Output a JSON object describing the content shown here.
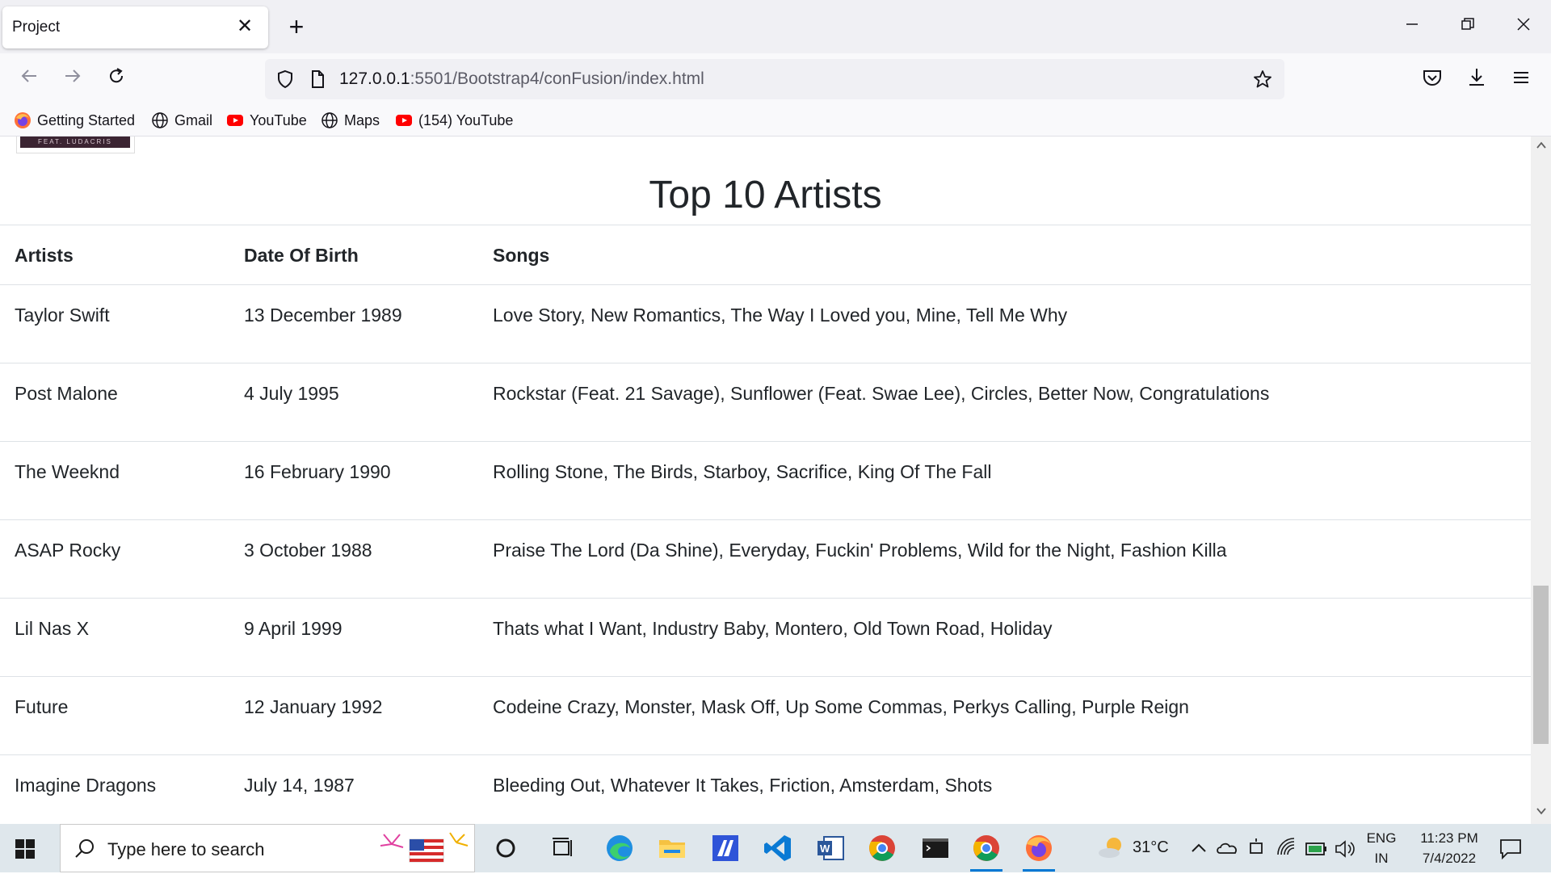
{
  "browser": {
    "tab_title": "Project",
    "url_host": "127.0.0.1",
    "url_rest": ":5501/Bootstrap4/conFusion/index.html",
    "bookmarks": [
      {
        "label": "Getting Started",
        "icon": "firefox-icon"
      },
      {
        "label": "Gmail",
        "icon": "globe-icon"
      },
      {
        "label": "YouTube",
        "icon": "youtube-icon"
      },
      {
        "label": "Maps",
        "icon": "globe-icon"
      },
      {
        "label": "(154) YouTube",
        "icon": "youtube-icon"
      }
    ]
  },
  "page": {
    "image_caption": "FEAT. LUDACRIS",
    "title": "Top 10 Artists",
    "table": {
      "headers": [
        "Artists",
        "Date Of Birth",
        "Songs"
      ],
      "rows": [
        [
          "Taylor Swift",
          "13 December 1989",
          "Love Story, New Romantics, The Way I Loved you, Mine, Tell Me Why"
        ],
        [
          "Post Malone",
          "4 July 1995",
          "Rockstar (Feat. 21 Savage), Sunflower (Feat. Swae Lee), Circles, Better Now, Congratulations"
        ],
        [
          "The Weeknd",
          "16 February 1990",
          "Rolling Stone, The Birds, Starboy, Sacrifice, King Of The Fall"
        ],
        [
          "ASAP Rocky",
          "3 October 1988",
          "Praise The Lord (Da Shine), Everyday, Fuckin' Problems, Wild for the Night, Fashion Killa"
        ],
        [
          "Lil Nas X",
          "9 April 1999",
          "Thats what I Want, Industry Baby, Montero, Old Town Road, Holiday"
        ],
        [
          "Future",
          "12 January 1992",
          "Codeine Crazy, Monster, Mask Off, Up Some Commas, Perkys Calling, Purple Reign"
        ],
        [
          "Imagine Dragons",
          "July 14, 1987",
          "Bleeding Out, Whatever It Takes, Friction, Amsterdam, Shots"
        ]
      ]
    }
  },
  "taskbar": {
    "search_placeholder": "Type here to search",
    "weather": "31°C",
    "lang_top": "ENG",
    "lang_bottom": "IN",
    "time": "11:23 PM",
    "date": "7/4/2022"
  },
  "colors": {
    "tabstrip_bg": "#f0f0f4",
    "taskbar_bg": "#dfe7ec",
    "accent": "#0078d4",
    "youtube_red": "#ff0000"
  }
}
